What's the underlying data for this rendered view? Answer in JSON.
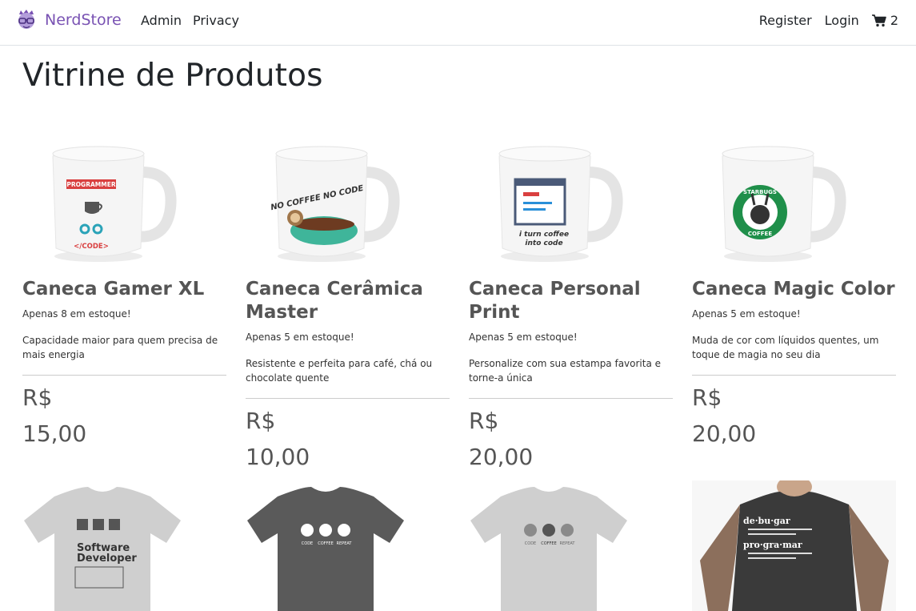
{
  "navbar": {
    "brand": "NerdStore",
    "links": [
      "Admin",
      "Privacy"
    ],
    "register": "Register",
    "login": "Login",
    "cart_count": "2"
  },
  "main": {
    "title": "Vitrine de Produtos",
    "products": [
      {
        "name": "Caneca Gamer XL",
        "stock": "Apenas 8 em estoque!",
        "description": "Capacidade maior para quem precisa de mais energia",
        "currency": "R$",
        "price": "15,00",
        "mug_text": [
          "PROGRAMMER",
          "</CODE>"
        ]
      },
      {
        "name": "Caneca Cerâmica Master",
        "stock": "Apenas 5 em estoque!",
        "description": "Resistente e perfeita para café, chá ou chocolate quente",
        "currency": "R$",
        "price": "10,00",
        "mug_text": [
          "NO COFFEE NO CODE"
        ]
      },
      {
        "name": "Caneca Personal Print",
        "stock": "Apenas 5 em estoque!",
        "description": "Personalize com sua estampa favorita e torne-a única",
        "currency": "R$",
        "price": "20,00",
        "mug_text": [
          "i turn coffee",
          "into code"
        ]
      },
      {
        "name": "Caneca Magic Color",
        "stock": "Apenas 5 em estoque!",
        "description": "Muda de cor com líquidos quentes, um toque de magia no seu dia",
        "currency": "R$",
        "price": "20,00",
        "mug_text": [
          "STARBUGS",
          "COFFEE"
        ]
      }
    ],
    "shirts": [
      {
        "text": [
          "Software",
          "Developer"
        ]
      },
      {
        "text": [
          "CODE",
          "COFFEE",
          "REPEAT"
        ]
      },
      {
        "text": [
          "CODE",
          "COFFEE",
          "REPEAT"
        ]
      },
      {
        "text": [
          "de·bu·gar",
          "pro·gra·mar"
        ]
      }
    ]
  },
  "colors": {
    "brand": "#7952b3",
    "text": "#212529",
    "muted": "#555555"
  }
}
